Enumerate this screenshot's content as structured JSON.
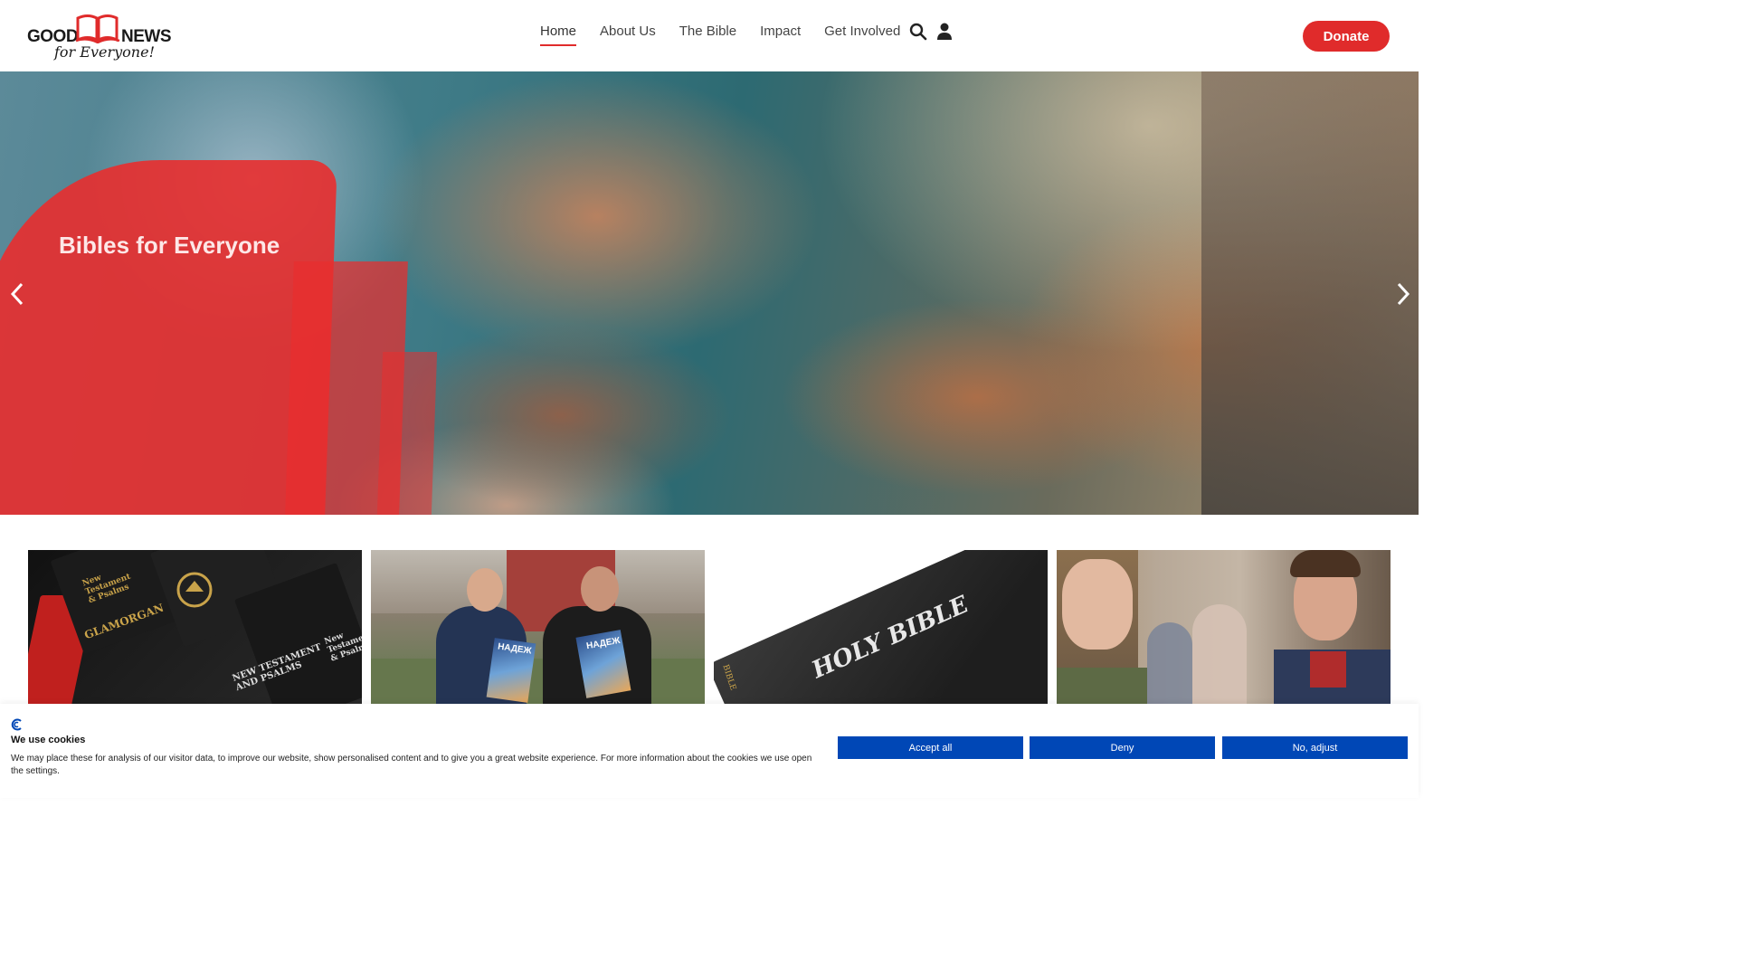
{
  "logo": {
    "word1": "GOOD",
    "word2": "NEWS",
    "tagline": "for Everyone!"
  },
  "nav": {
    "items": [
      {
        "label": "Home",
        "active": true
      },
      {
        "label": "About Us"
      },
      {
        "label": "The Bible"
      },
      {
        "label": "Impact"
      },
      {
        "label": "Get Involved"
      }
    ]
  },
  "header": {
    "donate_label": "Donate"
  },
  "hero": {
    "title": "Bibles for Everyone"
  },
  "cards": {
    "card1": {
      "texts": [
        "New Testament & Psalms",
        "GLAMORGAN",
        "NEW TESTAMENT AND PSALMS",
        "New Testament & Psalms"
      ]
    },
    "card2": {
      "texts": [
        "НАДЕЖ",
        "НАДЕЖ"
      ]
    },
    "card3": {
      "texts": [
        "HOLY BIBLE",
        "BIBLE"
      ]
    }
  },
  "cookie": {
    "title": "We use cookies",
    "text": "We may place these for analysis of our visitor data, to improve our website, show personalised content and to give you a great website experience. For more information about the cookies we use open the settings.",
    "accept_label": "Accept all",
    "deny_label": "Deny",
    "adjust_label": "No, adjust"
  },
  "colors": {
    "brand_red": "#e02b2b",
    "cookie_button": "#0047b6"
  }
}
